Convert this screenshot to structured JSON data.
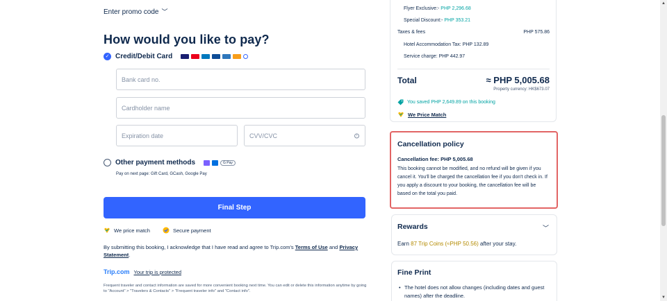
{
  "promo": {
    "label": "Enter promo code"
  },
  "payment": {
    "title": "How would you like to pay?",
    "credit": {
      "label": "Credit/Debit Card"
    },
    "fields": {
      "card_no": "Bank card no.",
      "holder": "Cardholder name",
      "expiry": "Expiration date",
      "cvv": "CVV/CVC"
    },
    "other": {
      "label": "Other payment methods",
      "sub": "Pay on next page: Gift Card, GCash, Google Pay",
      "gpay": "G Pay"
    },
    "final_button": "Final Step",
    "badges": {
      "price_match": "We price match",
      "secure": "Secure payment"
    },
    "terms": {
      "prefix": "By submitting this booking, I acknowledge that I have read and agree to Trip.com's",
      "terms_of_use": "Terms of Use",
      "and": "and",
      "privacy": "Privacy Statement"
    },
    "trip": {
      "logo": "Trip.com",
      "protected": "Your trip is protected"
    },
    "footnote": "Frequent traveler and contact information are saved for more convenient booking next time. You can edit or delete this information anytime by going to \"Account\" > \"Travelers & Contacts\" > \"Frequent traveler info\" and \"Contact info\"."
  },
  "price": {
    "flyer_label": "Flyer Exclusive:-",
    "flyer_value": "PHP 2,296.68",
    "special_label": "Special Discount:-",
    "special_value": "PHP 353.21",
    "taxes_label": "Taxes & fees",
    "taxes_value": "PHP 575.86",
    "hotel_tax": "Hotel Accommodation Tax: PHP 132.89",
    "service": "Service charge: PHP 442.97",
    "total_label": "Total",
    "total_value": "≈ PHP 5,005.68",
    "currency": "Property currency: HK$673.07",
    "saved": "You saved PHP 2,649.89 on this booking",
    "price_match": "We Price Match"
  },
  "cancellation": {
    "title": "Cancellation policy",
    "fee": "Cancellation fee: PHP 5,005.68",
    "text": "This booking cannot be modified, and no refund will be given if you cancel it. You'll be charged the cancellation fee if you don't check in. If you apply a discount to your booking, the cancellation fee will be based on the total you paid."
  },
  "rewards": {
    "title": "Rewards",
    "earn": "Earn",
    "coins": "87 Trip Coins (≈PHP 50.56)",
    "after": "after your stay."
  },
  "fine_print": {
    "title": "Fine Print",
    "item1": "The hotel does not allow changes (including dates and guest names) after the deadline."
  },
  "colors": {
    "accent": "#3264ff",
    "teal": "#00a3a3",
    "alert": "#e26464",
    "gold": "#b38a00"
  }
}
